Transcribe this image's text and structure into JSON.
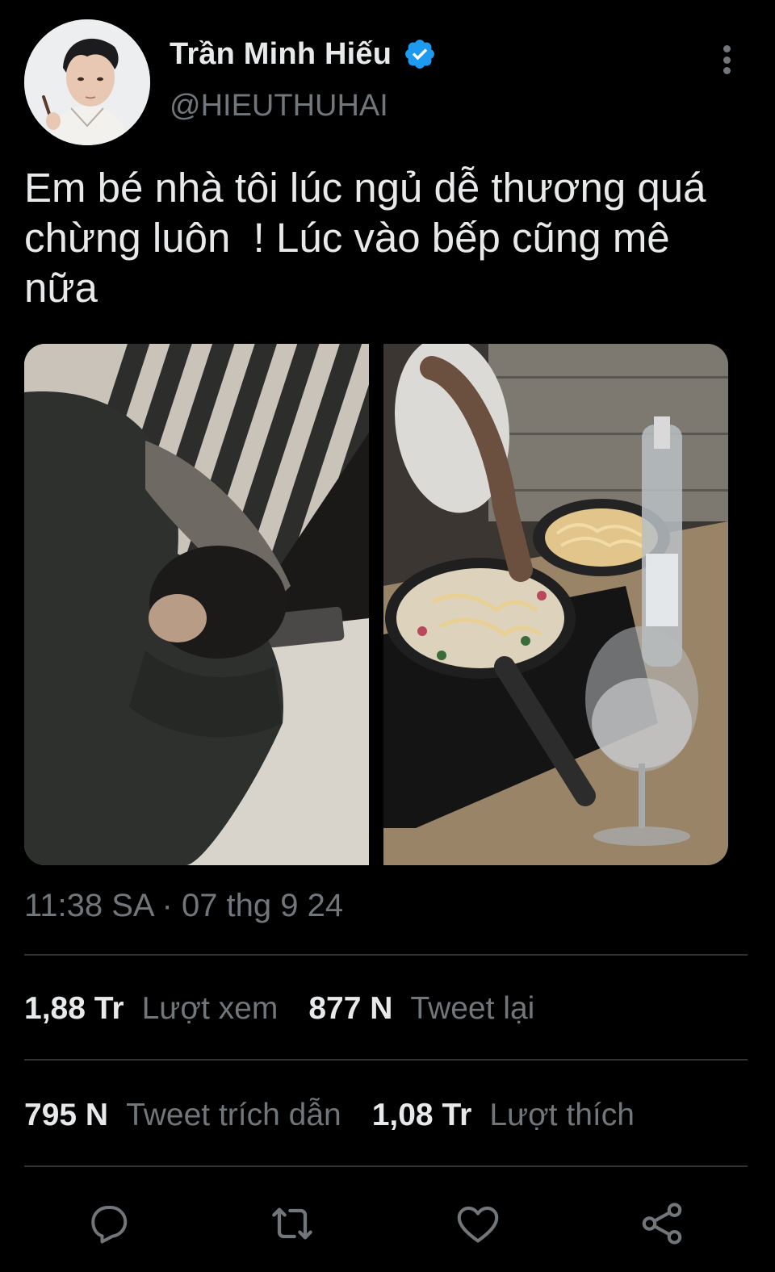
{
  "author": {
    "display_name": "Trần Minh Hiếu",
    "handle": "@HIEUTHUHAI",
    "verified": true,
    "avatar_icon": "profile-photo"
  },
  "tweet": {
    "text": "Em bé nhà tôi lúc ngủ dễ thương quá\nchừng luôn  ! Lúc vào bếp cũng mê\nnữa",
    "timestamp": "11:38 SA · 07 thg 9 24",
    "media": [
      {
        "icon": "sleeping-person-photo"
      },
      {
        "icon": "cooking-pasta-photo"
      }
    ]
  },
  "stats": {
    "views_count": "1,88 Tr",
    "views_label": "Lượt xem",
    "retweets_count": "877 N",
    "retweets_label": "Tweet lại",
    "quotes_count": "795 N",
    "quotes_label": "Tweet trích dẫn",
    "likes_count": "1,08 Tr",
    "likes_label": "Lượt thích"
  },
  "actions": [
    {
      "icon": "reply-icon"
    },
    {
      "icon": "retweet-icon"
    },
    {
      "icon": "like-icon"
    },
    {
      "icon": "share-icon"
    }
  ],
  "colors": {
    "background": "#000000",
    "text_primary": "#e7e9ea",
    "text_secondary": "#71767b",
    "divider": "#2f3336",
    "verified_blue": "#1d9bf0"
  }
}
